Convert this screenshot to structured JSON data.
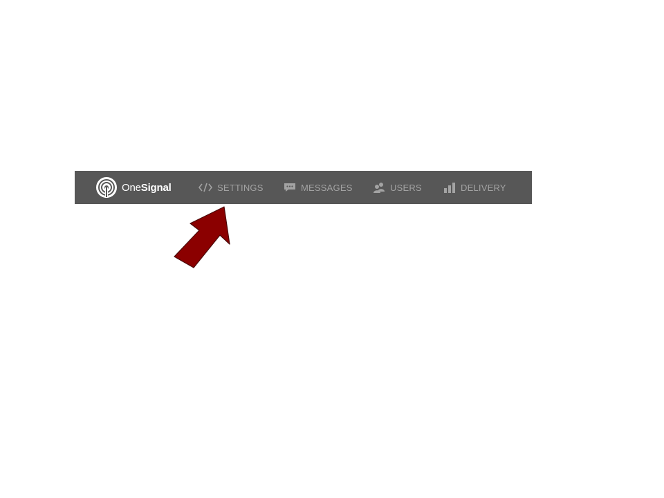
{
  "brand": {
    "name_part1": "One",
    "name_part2": "Signal",
    "logo_icon": "onesignal-logo-icon"
  },
  "nav": {
    "items": [
      {
        "label": "SETTINGS",
        "icon": "code-icon"
      },
      {
        "label": "MESSAGES",
        "icon": "chat-bubble-icon"
      },
      {
        "label": "USERS",
        "icon": "users-icon"
      },
      {
        "label": "DELIVERY",
        "icon": "bar-chart-icon"
      }
    ]
  },
  "colors": {
    "navbar_bg": "#575757",
    "nav_text": "#a3a3a3",
    "brand_text": "#ffffff",
    "arrow_fill": "#8b0000"
  },
  "annotation": {
    "arrow_icon": "pointer-arrow-icon"
  }
}
